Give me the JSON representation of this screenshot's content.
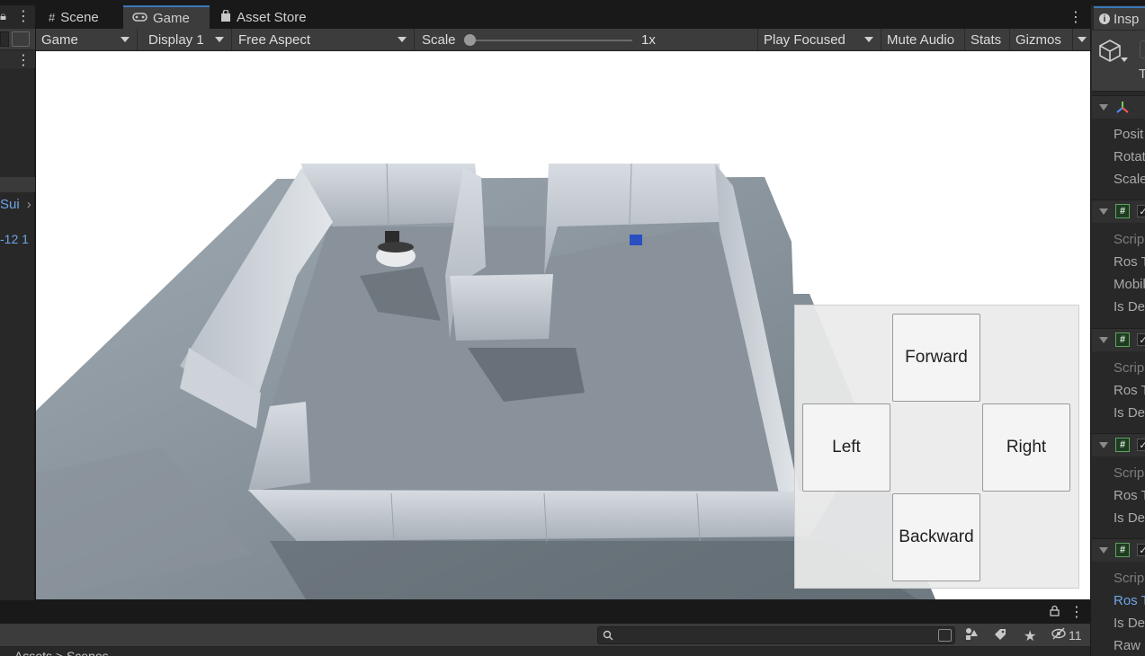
{
  "left_panel": {
    "item_1": "Sui",
    "item_2": "-12 1"
  },
  "tabs": [
    {
      "label": "Scene",
      "icon": "grid-icon"
    },
    {
      "label": "Game",
      "icon": "gamepad-icon"
    },
    {
      "label": "Asset Store",
      "icon": "shopping-bag-icon"
    }
  ],
  "toolbar": {
    "game_dropdown": "Game",
    "display_dropdown": "Display 1",
    "aspect_dropdown": "Free Aspect",
    "scale_label": "Scale",
    "scale_value": "1x",
    "scale_fraction": 0.0,
    "play_focused": "Play Focused",
    "mute_audio": "Mute Audio",
    "stats": "Stats",
    "gizmos": "Gizmos"
  },
  "controls": {
    "forward": "Forward",
    "left": "Left",
    "right": "Right",
    "backward": "Backward"
  },
  "inspector": {
    "tab_label": "Insp",
    "object_letter": "T",
    "transform": [
      "Posit",
      "Rotat",
      "Scale"
    ],
    "component_1": [
      "Scrip",
      "Ros T",
      "Mobil",
      "Is De"
    ],
    "component_2": [
      "Scrip",
      "Ros T",
      "Is De"
    ],
    "component_3": [
      "Scrip",
      "Ros T",
      "Is De"
    ],
    "component_4": [
      "Scrip",
      "Ros T",
      "Is De",
      "Raw"
    ]
  },
  "bottom": {
    "breadcrumbs": "Assets > Scenes",
    "hidden_count": "11"
  },
  "colors": {
    "accent_blue": "#3a79bb",
    "link_blue": "#6ea6e6",
    "panel_dark": "#282828",
    "toolbar": "#3c3c3c"
  }
}
